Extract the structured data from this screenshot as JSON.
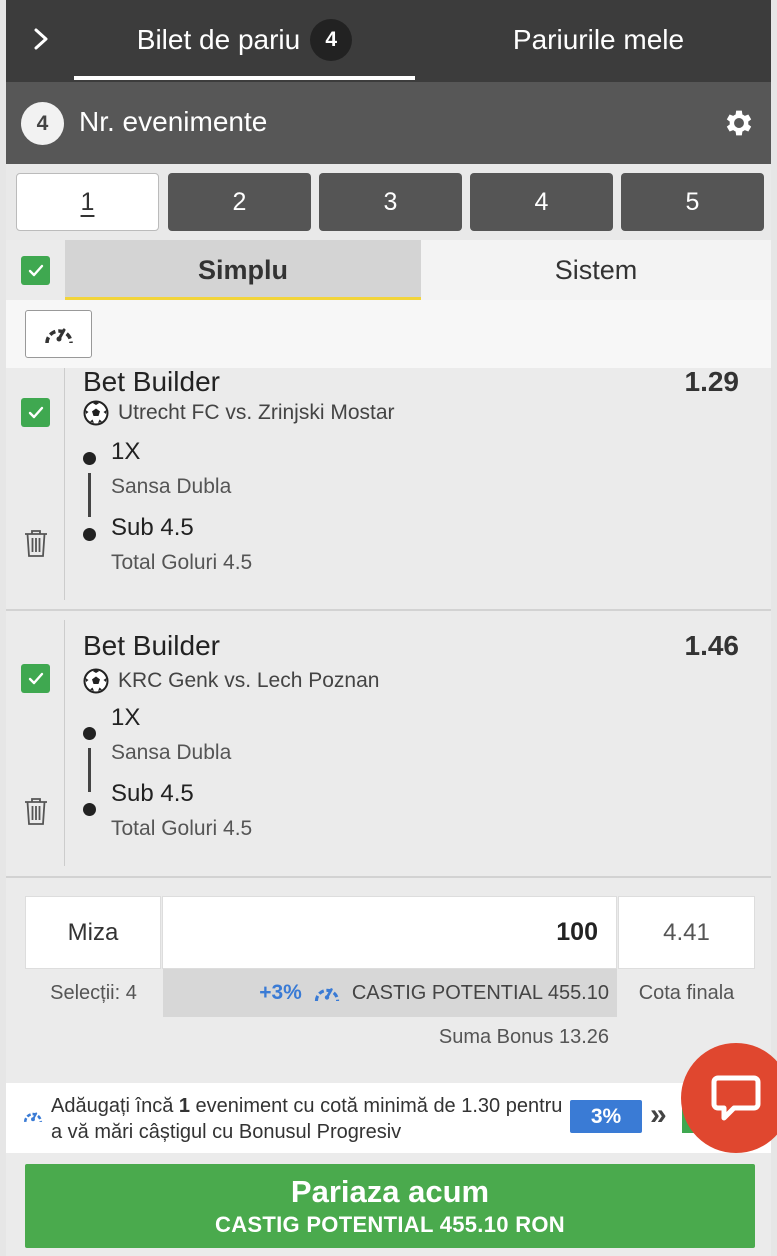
{
  "header": {
    "tab_ticket_label": "Bilet de pariu",
    "tab_ticket_count": "4",
    "tab_mybets_label": "Pariurile mele"
  },
  "events": {
    "count": "4",
    "label": "Nr. evenimente"
  },
  "ticket_tabs": [
    "1",
    "2",
    "3",
    "4",
    "5"
  ],
  "bet_type": {
    "simple": "Simplu",
    "system": "Sistem"
  },
  "bets": [
    {
      "title": "Bet Builder",
      "odds": "1.29",
      "match": "Utrecht FC vs. Zrinjski Mostar",
      "selections": [
        {
          "pick": "1X",
          "market": "Sansa Dubla"
        },
        {
          "pick": "Sub 4.5",
          "market": "Total Goluri 4.5"
        }
      ]
    },
    {
      "title": "Bet Builder",
      "odds": "1.46",
      "match": "KRC Genk vs. Lech Poznan",
      "selections": [
        {
          "pick": "1X",
          "market": "Sansa Dubla"
        },
        {
          "pick": "Sub 4.5",
          "market": "Total Goluri 4.5"
        }
      ]
    }
  ],
  "stake": {
    "label": "Miza",
    "value": "100",
    "total_odds": "4.41",
    "selections_label": "Selecții: 4",
    "boost_pct": "+3%",
    "potential_label": "CASTIG POTENTIAL 455.10",
    "final_odds_label": "Cota finala",
    "bonus_label": "Suma Bonus 13.26"
  },
  "promo": {
    "text_before": "Adăugați încă ",
    "text_bold": "1",
    "text_after": " eveniment cu cotă minimă de 1.30 pentru a vă mări câștigul cu Bonusul Progresiv",
    "badge": "3%",
    "arrows": "»"
  },
  "place_bet": {
    "title": "Pariaza acum",
    "subtitle": "CASTIG POTENTIAL  455.10 RON"
  },
  "colors": {
    "dark_header": "#3c3c3c",
    "green": "#4aaa4d",
    "blue": "#3a7bd5",
    "chat_red": "#e0472f"
  }
}
